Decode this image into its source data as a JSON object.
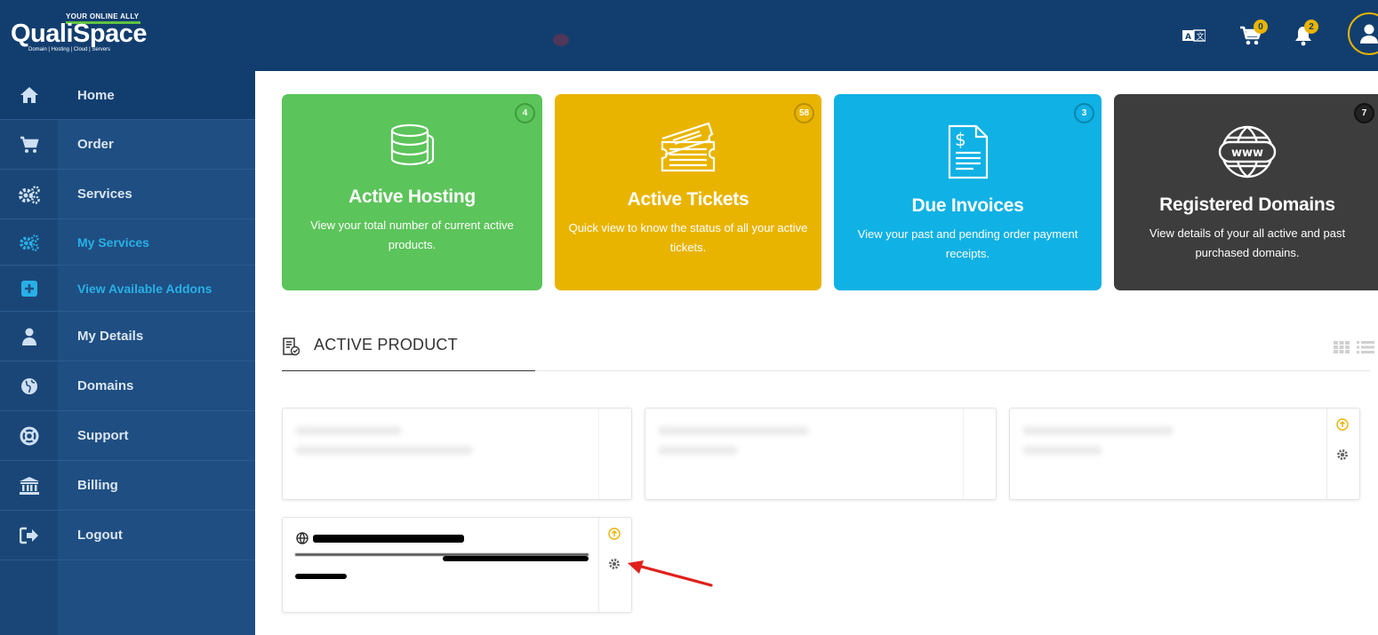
{
  "brand": {
    "name": "QualiSpace",
    "tagline": "YOUR ONLINE ALLY",
    "subtitle": "Domain | Hosting | Cloud | Servers"
  },
  "header": {
    "cart_count": "0",
    "notification_count": "2"
  },
  "sidebar": {
    "items": [
      {
        "label": "Home",
        "icon": "home-icon"
      },
      {
        "label": "Order",
        "icon": "cart-icon"
      },
      {
        "label": "Services",
        "icon": "gears-icon"
      },
      {
        "label": "My Services",
        "icon": "gears-icon"
      },
      {
        "label": "View Available Addons",
        "icon": "plus-square-icon"
      },
      {
        "label": "My Details",
        "icon": "user-icon"
      },
      {
        "label": "Domains",
        "icon": "globe-icon"
      },
      {
        "label": "Support",
        "icon": "lifebuoy-icon"
      },
      {
        "label": "Billing",
        "icon": "bank-icon"
      },
      {
        "label": "Logout",
        "icon": "sign-out-icon"
      }
    ]
  },
  "cards": [
    {
      "title": "Active Hosting",
      "count": "4",
      "description": "View your total number of current active products.",
      "color": "#5bc45a"
    },
    {
      "title": "Active Tickets",
      "count": "58",
      "description": "Quick view to know the  status of all your active tickets.",
      "color": "#e9b400"
    },
    {
      "title": "Due Invoices",
      "count": "3",
      "description": "View your past and pending order payment receipts.",
      "color": "#10b1e4"
    },
    {
      "title": "Registered Domains",
      "count": "7",
      "description": "View details of your all active and past purchased domains.",
      "color": "#3d3d3d"
    }
  ],
  "section": {
    "title": "ACTIVE PRODUCT"
  },
  "colors": {
    "topbar": "#123e6f",
    "sidebar": "#1f4e82",
    "accent": "#28b0e6",
    "badge": "#e9b400",
    "annotation_arrow": "#e0201b"
  }
}
